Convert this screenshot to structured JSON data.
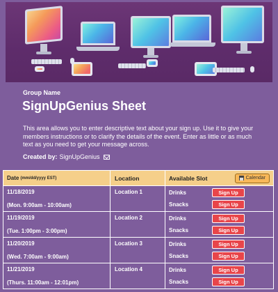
{
  "header": {
    "group_label": "Group Name",
    "title": "SignUpGenius Sheet",
    "description": "This area allows you to enter descriptive text about your sign up. Use it to give your members instructions or to clarify the details of the event. Enter as little or as much text as you need to get your message across.",
    "created_by_label": "Created by:",
    "created_by_name": "SignUpGenius"
  },
  "table": {
    "col_date": "Date",
    "col_date_hint": "(mm/dd/yyyy EST)",
    "col_location": "Location",
    "col_slot": "Available Slot",
    "calendar_label": "Calendar",
    "rows": [
      {
        "date": "11/18/2019",
        "time": "(Mon. 9:00am - 10:00am)",
        "location": "Location 1",
        "slots": [
          {
            "name": "Drinks",
            "button": "Sign Up"
          },
          {
            "name": "Snacks",
            "button": "Sign Up"
          }
        ]
      },
      {
        "date": "11/19/2019",
        "time": "(Tue. 1:00pm - 3:00pm)",
        "location": "Location 2",
        "slots": [
          {
            "name": "Drinks",
            "button": "Sign Up"
          },
          {
            "name": "Snacks",
            "button": "Sign Up"
          }
        ]
      },
      {
        "date": "11/20/2019",
        "time": "(Wed. 7:00am - 9:00am)",
        "location": "Location 3",
        "slots": [
          {
            "name": "Drinks",
            "button": "Sign Up"
          },
          {
            "name": "Snacks",
            "button": "Sign Up"
          }
        ]
      },
      {
        "date": "11/21/2019",
        "time": "(Thurs. 11:00am - 12:01pm)",
        "location": "Location 4",
        "slots": [
          {
            "name": "Drinks",
            "button": "Sign Up"
          },
          {
            "name": "Snacks",
            "button": "Sign Up"
          }
        ]
      }
    ]
  },
  "colors": {
    "page_background": "#7e5d9c",
    "banner_background": "#5e2c6b",
    "table_header": "#f5cf8a",
    "signup_button": "#e8454a",
    "calendar_button": "#f8b859"
  },
  "icons": {
    "envelope": "envelope-icon",
    "calendar": "calendar-icon"
  }
}
